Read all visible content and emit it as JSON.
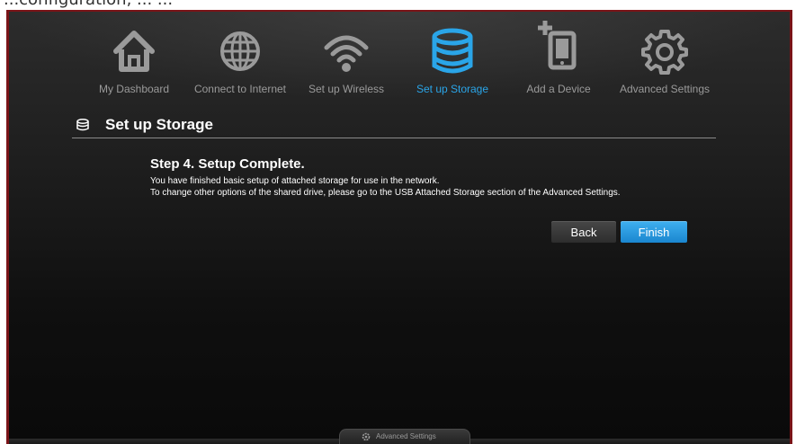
{
  "caption": {
    "text": "...configuration, ... ..."
  },
  "nav": {
    "items": [
      {
        "label": "My Dashboard",
        "icon": "home-icon"
      },
      {
        "label": "Connect to Internet",
        "icon": "globe-icon"
      },
      {
        "label": "Set up Wireless",
        "icon": "wifi-icon"
      },
      {
        "label": "Set up Storage",
        "icon": "storage-icon",
        "active": true
      },
      {
        "label": "Add a Device",
        "icon": "add-device-icon"
      },
      {
        "label": "Advanced Settings",
        "icon": "gear-icon"
      }
    ]
  },
  "section": {
    "title": "Set up Storage",
    "icon": "storage-icon"
  },
  "step": {
    "heading": "Step 4. Setup Complete.",
    "line1": "You have finished basic setup of attached storage for use in the network.",
    "line2": "To change other options of the shared drive, please go to the USB Attached Storage section of the Advanced Settings."
  },
  "buttons": {
    "back": "Back",
    "finish": "Finish"
  },
  "footer": {
    "tab_label": "Advanced Settings",
    "tab_icon": "gear-icon"
  },
  "colors": {
    "accent": "#2aa5e8",
    "frame": "#7a1418",
    "background": "#0f0f0f",
    "nav_inactive": "#9a9a9a"
  }
}
